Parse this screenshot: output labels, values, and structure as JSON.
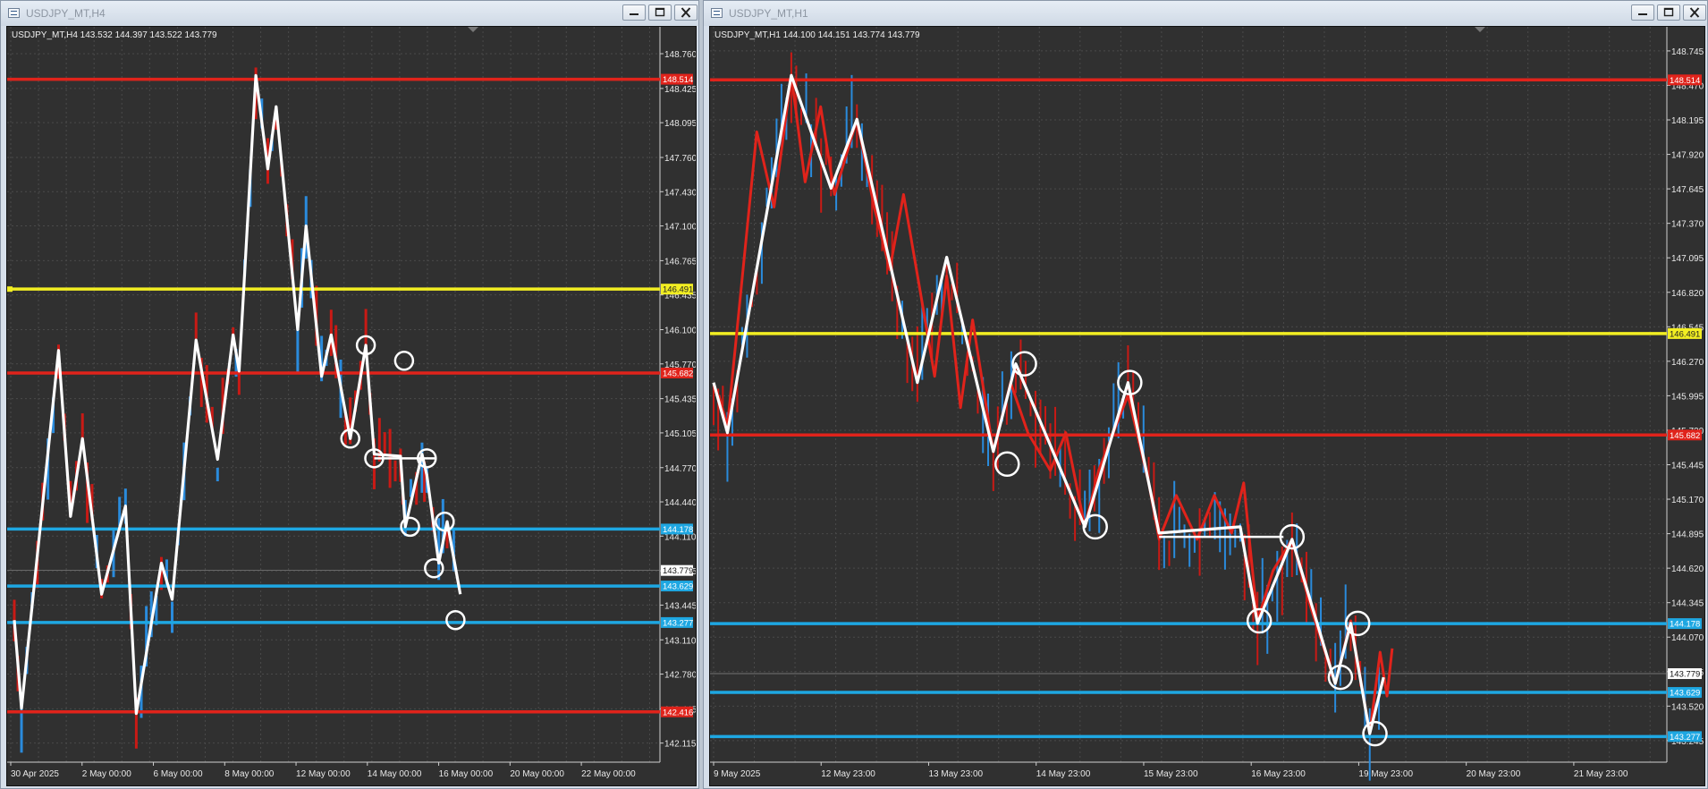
{
  "colors": {
    "background": "#303030",
    "grid": "#4a4a4a",
    "resistance": "#e0231b",
    "pivot": "#f2ee22",
    "support": "#1ea7e2",
    "zigzag": "#ffffff",
    "price_marker": "#ffffff"
  },
  "windows": [
    {
      "title": "USDJPY_MT,H4",
      "info": "USDJPY_MT,H4  143.532 144.397 143.522 143.779",
      "controls": {
        "minimize": "minimize-icon",
        "restore": "restore-icon",
        "close": "close-icon"
      }
    },
    {
      "title": "USDJPY_MT,H1",
      "info": "USDJPY_MT,H1  144.100 144.151 143.774 143.779",
      "controls": {
        "minimize": "minimize-icon",
        "restore": "restore-icon",
        "close": "close-icon"
      }
    }
  ],
  "chart_data": [
    {
      "type": "line",
      "symbol": "USDJPY_MT",
      "timeframe": "H4",
      "ohlc": {
        "open": 143.532,
        "high": 144.397,
        "low": 143.522,
        "close": 143.779
      },
      "y_ticks": [
        "148.760",
        "148.425",
        "148.095",
        "147.760",
        "147.430",
        "147.100",
        "146.765",
        "146.435",
        "146.100",
        "145.770",
        "145.435",
        "145.105",
        "144.770",
        "144.440",
        "144.110",
        "143.775",
        "143.445",
        "143.110",
        "142.780",
        "142.445",
        "142.115"
      ],
      "x_ticks": [
        "30 Apr 2025",
        "2 May 00:00",
        "6 May 00:00",
        "8 May 00:00",
        "12 May 00:00",
        "14 May 00:00",
        "16 May 00:00",
        "20 May 00:00",
        "22 May 00:00"
      ],
      "ylim": [
        142.0,
        148.95
      ],
      "current_price": "143.779",
      "levels": [
        {
          "label": "148.514",
          "value": 148.514,
          "kind": "resistance"
        },
        {
          "label": "146.491",
          "value": 146.491,
          "kind": "pivot"
        },
        {
          "label": "145.682",
          "value": 145.682,
          "kind": "resistance"
        },
        {
          "label": "144.178",
          "value": 144.178,
          "kind": "support"
        },
        {
          "label": "143.629",
          "value": 143.629,
          "kind": "support"
        },
        {
          "label": "143.277",
          "value": 143.277,
          "kind": "support"
        },
        {
          "label": "142.416",
          "value": 142.416,
          "kind": "resistance"
        }
      ],
      "zigzag": [
        {
          "x": 0.3,
          "y": 143.3
        },
        {
          "x": 0.9,
          "y": 142.45
        },
        {
          "x": 4.0,
          "y": 145.9
        },
        {
          "x": 5.0,
          "y": 144.3
        },
        {
          "x": 6.0,
          "y": 145.05
        },
        {
          "x": 7.6,
          "y": 143.55
        },
        {
          "x": 9.6,
          "y": 144.4
        },
        {
          "x": 10.5,
          "y": 142.4
        },
        {
          "x": 12.6,
          "y": 143.85
        },
        {
          "x": 13.5,
          "y": 143.5
        },
        {
          "x": 15.5,
          "y": 146.0
        },
        {
          "x": 17.3,
          "y": 144.85
        },
        {
          "x": 18.6,
          "y": 146.05
        },
        {
          "x": 19.1,
          "y": 145.7
        },
        {
          "x": 20.5,
          "y": 148.55
        },
        {
          "x": 21.5,
          "y": 147.65
        },
        {
          "x": 22.2,
          "y": 148.25
        },
        {
          "x": 24.0,
          "y": 146.1
        },
        {
          "x": 24.7,
          "y": 147.1
        },
        {
          "x": 26.0,
          "y": 145.65
        },
        {
          "x": 26.8,
          "y": 146.05
        },
        {
          "x": 28.4,
          "y": 145.05
        },
        {
          "x": 29.7,
          "y": 145.95
        },
        {
          "x": 30.4,
          "y": 144.9
        },
        {
          "x": 32.6,
          "y": 144.88
        },
        {
          "x": 33.0,
          "y": 144.2
        },
        {
          "x": 34.4,
          "y": 144.9
        },
        {
          "x": 34.8,
          "y": 144.7
        },
        {
          "x": 35.8,
          "y": 143.85
        },
        {
          "x": 36.5,
          "y": 144.25
        },
        {
          "x": 37.6,
          "y": 143.55
        }
      ],
      "hline": {
        "x1": 30.4,
        "x2": 35.6,
        "y": 144.86
      },
      "circles": [
        {
          "x": 28.4,
          "y": 145.05
        },
        {
          "x": 29.7,
          "y": 145.95
        },
        {
          "x": 30.4,
          "y": 144.86
        },
        {
          "x": 32.9,
          "y": 145.8
        },
        {
          "x": 33.4,
          "y": 144.2
        },
        {
          "x": 34.8,
          "y": 144.86
        },
        {
          "x": 36.3,
          "y": 144.25
        },
        {
          "x": 35.4,
          "y": 143.8
        },
        {
          "x": 37.2,
          "y": 143.3
        }
      ],
      "x_range": [
        0,
        54
      ]
    },
    {
      "type": "line",
      "symbol": "USDJPY_MT",
      "timeframe": "H1",
      "ohlc": {
        "open": 144.1,
        "high": 144.151,
        "low": 143.774,
        "close": 143.779
      },
      "y_ticks": [
        "148.745",
        "148.470",
        "148.195",
        "147.920",
        "147.645",
        "147.370",
        "147.095",
        "146.820",
        "146.545",
        "146.270",
        "145.995",
        "145.720",
        "145.445",
        "145.170",
        "144.895",
        "144.620",
        "144.345",
        "144.070",
        "143.795",
        "143.520",
        "143.245"
      ],
      "x_ticks": [
        "9 May 2025",
        "12 May 23:00",
        "13 May 23:00",
        "14 May 23:00",
        "15 May 23:00",
        "16 May 23:00",
        "19 May 23:00",
        "20 May 23:00",
        "21 May 23:00"
      ],
      "ylim": [
        143.13,
        148.88
      ],
      "current_price": "143.779",
      "levels": [
        {
          "label": "148.514",
          "value": 148.514,
          "kind": "resistance"
        },
        {
          "label": "146.491",
          "value": 146.491,
          "kind": "pivot"
        },
        {
          "label": "145.682",
          "value": 145.682,
          "kind": "resistance"
        },
        {
          "label": "144.178",
          "value": 144.178,
          "kind": "support"
        },
        {
          "label": "143.629",
          "value": 143.629,
          "kind": "support"
        },
        {
          "label": "143.277",
          "value": 143.277,
          "kind": "support"
        }
      ],
      "zigzag": [
        {
          "x": 0.0,
          "y": 146.1
        },
        {
          "x": 0.8,
          "y": 145.7
        },
        {
          "x": 4.5,
          "y": 148.55
        },
        {
          "x": 6.8,
          "y": 147.65
        },
        {
          "x": 8.3,
          "y": 148.2
        },
        {
          "x": 11.8,
          "y": 146.1
        },
        {
          "x": 13.5,
          "y": 147.1
        },
        {
          "x": 16.2,
          "y": 145.55
        },
        {
          "x": 17.5,
          "y": 146.25
        },
        {
          "x": 21.5,
          "y": 144.95
        },
        {
          "x": 24.0,
          "y": 146.1
        },
        {
          "x": 25.8,
          "y": 144.9
        },
        {
          "x": 30.5,
          "y": 144.95
        },
        {
          "x": 31.5,
          "y": 144.18
        },
        {
          "x": 33.5,
          "y": 144.85
        },
        {
          "x": 36.0,
          "y": 143.7
        },
        {
          "x": 36.9,
          "y": 144.18
        },
        {
          "x": 38.0,
          "y": 143.3
        },
        {
          "x": 38.8,
          "y": 143.75
        }
      ],
      "red_wave": [
        {
          "x": 0.3,
          "y": 146.0
        },
        {
          "x": 0.8,
          "y": 145.75
        },
        {
          "x": 2.5,
          "y": 148.1
        },
        {
          "x": 3.5,
          "y": 147.5
        },
        {
          "x": 4.5,
          "y": 148.55
        },
        {
          "x": 5.3,
          "y": 147.7
        },
        {
          "x": 6.2,
          "y": 148.3
        },
        {
          "x": 7.0,
          "y": 147.6
        },
        {
          "x": 8.3,
          "y": 148.2
        },
        {
          "x": 9.3,
          "y": 147.5
        },
        {
          "x": 10.2,
          "y": 147.0
        },
        {
          "x": 11.0,
          "y": 147.6
        },
        {
          "x": 12.0,
          "y": 146.8
        },
        {
          "x": 12.8,
          "y": 146.15
        },
        {
          "x": 13.5,
          "y": 146.95
        },
        {
          "x": 14.3,
          "y": 145.9
        },
        {
          "x": 15.0,
          "y": 146.6
        },
        {
          "x": 16.2,
          "y": 145.55
        },
        {
          "x": 17.2,
          "y": 146.1
        },
        {
          "x": 18.2,
          "y": 145.7
        },
        {
          "x": 19.5,
          "y": 145.4
        },
        {
          "x": 20.4,
          "y": 145.7
        },
        {
          "x": 21.5,
          "y": 144.95
        },
        {
          "x": 22.3,
          "y": 145.4
        },
        {
          "x": 24.0,
          "y": 146.0
        },
        {
          "x": 25.2,
          "y": 145.3
        },
        {
          "x": 25.8,
          "y": 144.85
        },
        {
          "x": 26.8,
          "y": 145.2
        },
        {
          "x": 28.0,
          "y": 144.85
        },
        {
          "x": 29.0,
          "y": 145.2
        },
        {
          "x": 30.0,
          "y": 144.9
        },
        {
          "x": 30.7,
          "y": 145.3
        },
        {
          "x": 31.5,
          "y": 144.2
        },
        {
          "x": 32.4,
          "y": 144.6
        },
        {
          "x": 33.5,
          "y": 144.85
        },
        {
          "x": 34.6,
          "y": 144.3
        },
        {
          "x": 36.0,
          "y": 143.7
        },
        {
          "x": 36.9,
          "y": 144.2
        },
        {
          "x": 38.0,
          "y": 143.3
        },
        {
          "x": 38.6,
          "y": 143.95
        },
        {
          "x": 39.0,
          "y": 143.6
        },
        {
          "x": 39.3,
          "y": 143.98
        }
      ],
      "hline": {
        "x1": 25.8,
        "x2": 33.0,
        "y": 144.87
      },
      "circles": [
        {
          "x": 17.0,
          "y": 145.45
        },
        {
          "x": 18.0,
          "y": 146.25
        },
        {
          "x": 22.1,
          "y": 144.95
        },
        {
          "x": 24.1,
          "y": 146.1
        },
        {
          "x": 31.6,
          "y": 144.2
        },
        {
          "x": 33.5,
          "y": 144.87
        },
        {
          "x": 36.3,
          "y": 143.75
        },
        {
          "x": 37.3,
          "y": 144.18
        },
        {
          "x": 38.3,
          "y": 143.3
        }
      ],
      "x_range": [
        0,
        55
      ]
    }
  ]
}
